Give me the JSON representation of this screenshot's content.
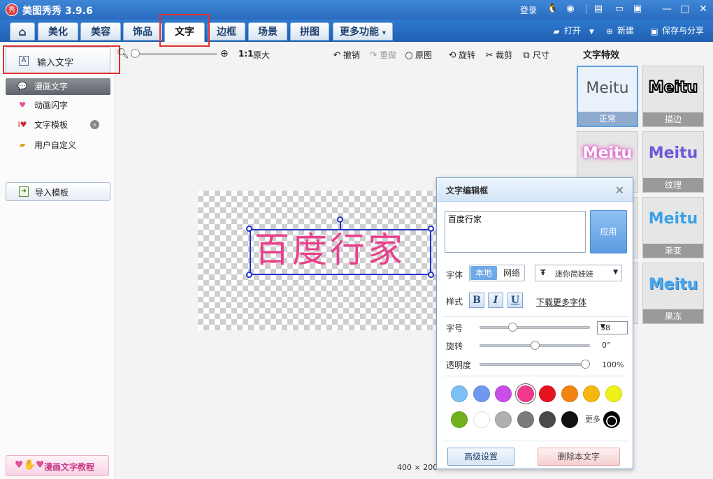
{
  "title_bar": {
    "app_logo": "秀",
    "app_title": "美图秀秀 3.9.6",
    "login_label": "登录"
  },
  "tabs": [
    {
      "label": "美化"
    },
    {
      "label": "美容"
    },
    {
      "label": "饰品"
    },
    {
      "label": "文字"
    },
    {
      "label": "边框"
    },
    {
      "label": "场景"
    },
    {
      "label": "拼图"
    },
    {
      "label": "更多功能"
    }
  ],
  "tab_more_caret": "▾",
  "right_tools": {
    "open_label": "打开",
    "new_label": "新建",
    "save_label": "保存与分享"
  },
  "left_panel": {
    "input_text_label": "输入文字",
    "items": [
      {
        "label": "漫画文字"
      },
      {
        "label": "动画闪字"
      },
      {
        "label": "文字模板"
      },
      {
        "label": "用户自定义"
      }
    ],
    "import_label": "导入模板",
    "tutorial_label": "漫画文字教程"
  },
  "canvas_toolbar": {
    "zoom_ratio": "1:1",
    "original_size_label": "原大",
    "undo_label": "撤销",
    "redo_label": "重做",
    "original_label": "原图",
    "rotate_label": "旋转",
    "crop_label": "裁剪",
    "size_label": "尺寸"
  },
  "canvas": {
    "text": "百度行家",
    "status_size": "400 × 200"
  },
  "effects": {
    "title": "文字特效",
    "sample_text": "Meitu",
    "items": [
      {
        "label": "正常"
      },
      {
        "label": "描边"
      },
      {
        "label": "纹理"
      },
      {
        "label": "渐变"
      },
      {
        "label": "果冻"
      }
    ]
  },
  "dialog": {
    "title": "文字编辑框",
    "text_value": "百度行家",
    "apply_label": "应用",
    "font_label": "字体",
    "font_source_local": "本地",
    "font_source_web": "网络",
    "font_value": "迷你简娃娃",
    "style_label": "样式",
    "bold_label": "B",
    "italic_label": "I",
    "underline_label": "U",
    "more_fonts_label": "下载更多字体",
    "size_label": "字号",
    "size_value": "58",
    "size_fraction": 0.28,
    "rotate_label": "旋转",
    "rotate_value": "0°",
    "rotate_fraction": 0.5,
    "opacity_label": "透明度",
    "opacity_value": "100%",
    "opacity_fraction": 1.0,
    "colors_row1": [
      "#7cc0f5",
      "#6f98f0",
      "#c84ee6",
      "#f0398c",
      "#e6141e",
      "#f28412",
      "#f7b80e",
      "#eef21a"
    ],
    "colors_row2": [
      "#6fb21e",
      "#ffffff",
      "#b0b0b0",
      "#7a7a7a",
      "#4a4a4a",
      "#111111"
    ],
    "selected_color": "#f0398c",
    "more_colors_label": "更多",
    "advanced_label": "高级设置",
    "delete_label": "删除本文字"
  }
}
